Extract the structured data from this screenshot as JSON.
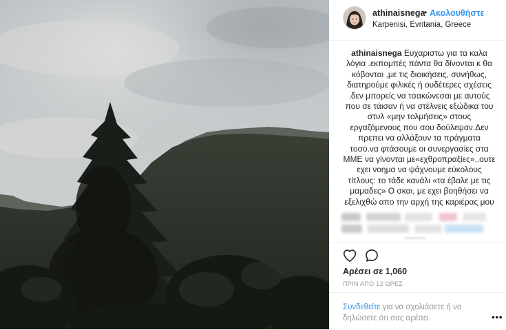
{
  "photo": {
    "subject": "mountain-fir-tree-landscape"
  },
  "header": {
    "username": "athinaisnega",
    "separator": "•",
    "follow_label": "Ακολουθήστε",
    "location": "Karpenisi, Evritania, Greece"
  },
  "caption": {
    "username": "athinaisnega",
    "text": "Ευχαριστω για τα καλα λόγια .εκπομπές πάντα θα δίνονται κ θα κόβονται ,με τις διοικήσεις, συνήθως, διατηρούμε φιλικές ή ουδέτερες σχέσεις .δεν μπορείς να τσακώνεσαι με αυτούς που σε τάισαν ή να στέλνεις εξώδικα του στυλ «μην τολμήσεις» στους εργαζόμενους που σου δούλεψαν.Δεν πρεπει να αλλάξουν τα πράγματα τοσο.να φτάσουμε οι συνεργασίες στα ΜΜΕ να γίνονται με«εχθροπραξίες»..ουτε εχει νοημα να ψάχνουμε εύκολους τίτλους: το τάδε κανάλι «τα έβαλε με τις μαμαδες» Ο σκαι, με εχει βοηθήσει να εξελιχθώ απο την αρχή της καριέρας μου κ με θυμώνει που τον απαχαιρετώ ετσι.."
  },
  "actions": {
    "like_icon": "heart-outline",
    "comment_icon": "speech-bubble-outline"
  },
  "likes": {
    "label": "Αρέσει σε 1,060"
  },
  "timestamp": "ΠΡΙΝ ΑΠΟ 12 ΩΡΕΣ",
  "login_prompt": {
    "link": "Συνδεθείτε",
    "text": " για να σχολιάσετε ή να δηλώσετε ότι σας αρέσει.",
    "more_icon": "•••"
  },
  "colors": {
    "link": "#3897f0",
    "muted": "#999999",
    "text": "#262626"
  }
}
